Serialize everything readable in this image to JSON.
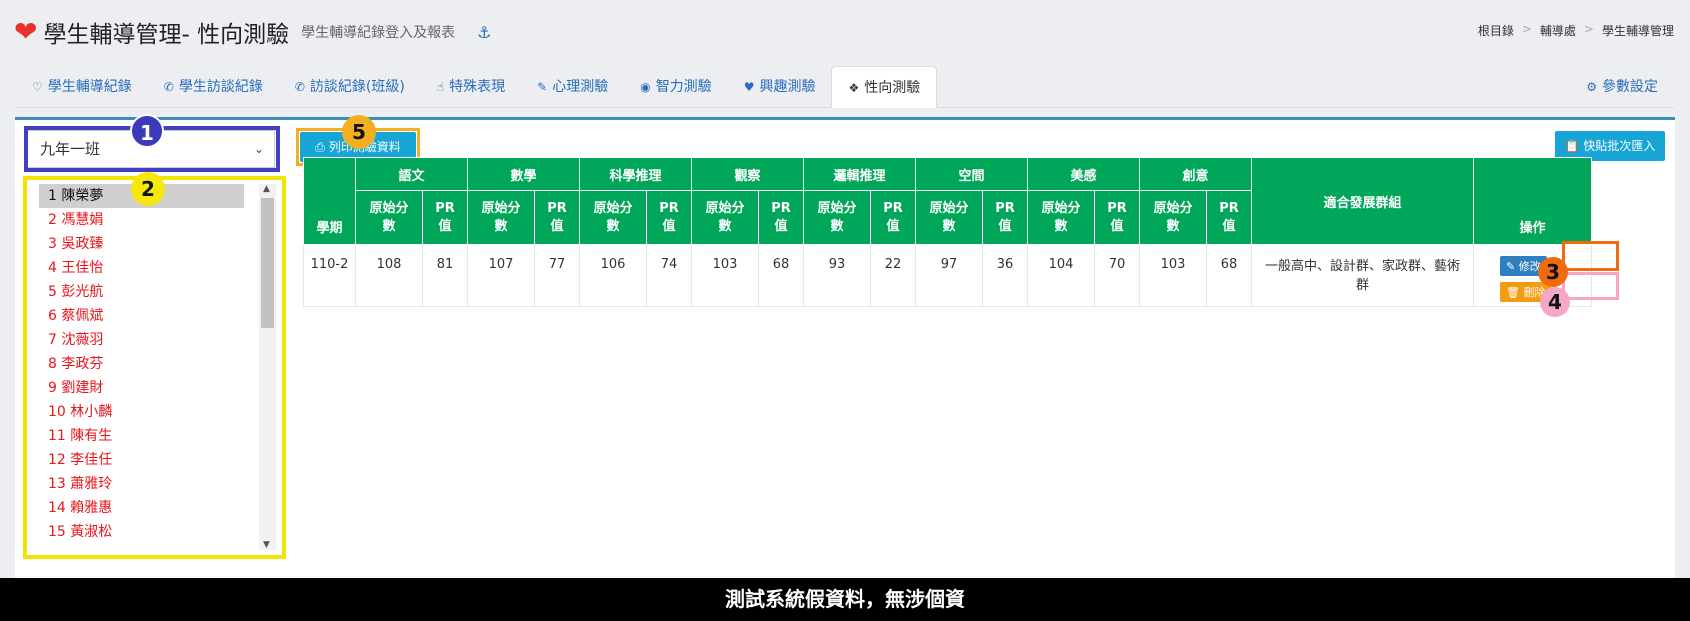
{
  "header": {
    "title": "學生輔導管理- 性向測驗",
    "subtitle": "學生輔導紀錄登入及報表",
    "breadcrumb": [
      "根目錄",
      "輔導處",
      "學生輔導管理"
    ]
  },
  "tabs": [
    {
      "label": "學生輔導紀錄",
      "icon": "heart-outline-icon",
      "glyph": "♡"
    },
    {
      "label": "學生訪談紀錄",
      "icon": "phone-icon",
      "glyph": "✆"
    },
    {
      "label": "訪談紀錄(班級)",
      "icon": "phone-wave-icon",
      "glyph": "✆"
    },
    {
      "label": "特殊表現",
      "icon": "thumbs-up-icon",
      "glyph": "👍"
    },
    {
      "label": "心理測驗",
      "icon": "edit-icon",
      "glyph": "✎"
    },
    {
      "label": "智力測驗",
      "icon": "eye-icon",
      "glyph": "◉"
    },
    {
      "label": "興趣測驗",
      "icon": "heartbeat-icon",
      "glyph": "♥"
    },
    {
      "label": "性向測驗",
      "icon": "cubes-icon",
      "glyph": "❖",
      "active": true
    }
  ],
  "settings_tab": {
    "label": "參數設定",
    "icon": "gear-icon"
  },
  "class_select": {
    "value": "九年一班"
  },
  "students": [
    "1 陳榮夢",
    "2 馮慧娟",
    "3 吳政臻",
    "4 王佳怡",
    "5 彭光航",
    "6 蔡佩斌",
    "7 沈薇羽",
    "8 李政芬",
    "9 劉建財",
    "10 林小麟",
    "11 陳有生",
    "12 李佳任",
    "13 蕭雅玲",
    "14 賴雅惠",
    "15 黃淑松"
  ],
  "selected_student_index": 0,
  "buttons": {
    "print": "列印測驗資料",
    "paste": "快貼批次匯入"
  },
  "table": {
    "term_header": "學期",
    "subjects": [
      "語文",
      "數學",
      "科學推理",
      "觀察",
      "邏輯推理",
      "空間",
      "美感",
      "創意"
    ],
    "raw_header": "原始分數",
    "pr_header": "PR值",
    "group_header": "適合發展群組",
    "action_header": "操作",
    "rows": [
      {
        "term": "110-2",
        "scores": [
          108,
          81,
          107,
          77,
          106,
          74,
          103,
          68,
          93,
          22,
          97,
          36,
          104,
          70,
          103,
          68
        ],
        "group": "一般高中、設計群、家政群、藝術群",
        "edit": "修改",
        "delete": "刪除"
      }
    ]
  },
  "badges": [
    "1",
    "2",
    "3",
    "4",
    "5"
  ],
  "banner": "測試系統假資料，無涉個資",
  "colors": {
    "accent": "#00a65a",
    "link": "#2a6ebb",
    "button": "#16a5d5",
    "student_name": "#e8151b"
  }
}
